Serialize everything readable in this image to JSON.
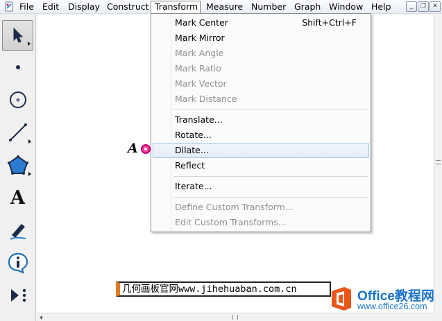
{
  "menubar": {
    "items": [
      "File",
      "Edit",
      "Display",
      "Construct",
      "Transform",
      "Measure",
      "Number",
      "Graph",
      "Window",
      "Help"
    ],
    "active": "Transform",
    "window_controls": {
      "minimize": "_",
      "restore": "❐",
      "close": "✕"
    }
  },
  "transform_menu": {
    "items": [
      {
        "label": "Mark Center",
        "shortcut": "Shift+Ctrl+F",
        "enabled": true
      },
      {
        "label": "Mark Mirror",
        "enabled": true
      },
      {
        "label": "Mark Angle",
        "enabled": false
      },
      {
        "label": "Mark Ratio",
        "enabled": false
      },
      {
        "label": "Mark Vector",
        "enabled": false
      },
      {
        "label": "Mark Distance",
        "enabled": false
      },
      {
        "label": "Translate...",
        "enabled": true
      },
      {
        "label": "Rotate...",
        "enabled": true
      },
      {
        "label": "Dilate...",
        "enabled": true,
        "highlighted": true
      },
      {
        "label": "Reflect",
        "enabled": true
      },
      {
        "label": "Iterate...",
        "enabled": true
      },
      {
        "label": "Define Custom Transform...",
        "enabled": false
      },
      {
        "label": "Edit Custom Transforms...",
        "enabled": false
      }
    ]
  },
  "toolbox": {
    "tools": [
      "arrow-tool",
      "point-tool",
      "compass-tool",
      "straightedge-tool",
      "polygon-tool",
      "text-tool",
      "marker-tool",
      "information-tool",
      "custom-tool"
    ],
    "selected": "arrow-tool",
    "text_tool_glyph": "A"
  },
  "canvas": {
    "point_label": "A",
    "point_color": "#ff3fa0",
    "caption": "几何画板官网www.jihehuaban.com.cn"
  },
  "watermark": {
    "title": "Office教程网",
    "url": "www.office26.com",
    "brand_color": "#1a73c9",
    "logo_color": "#e8561a"
  }
}
